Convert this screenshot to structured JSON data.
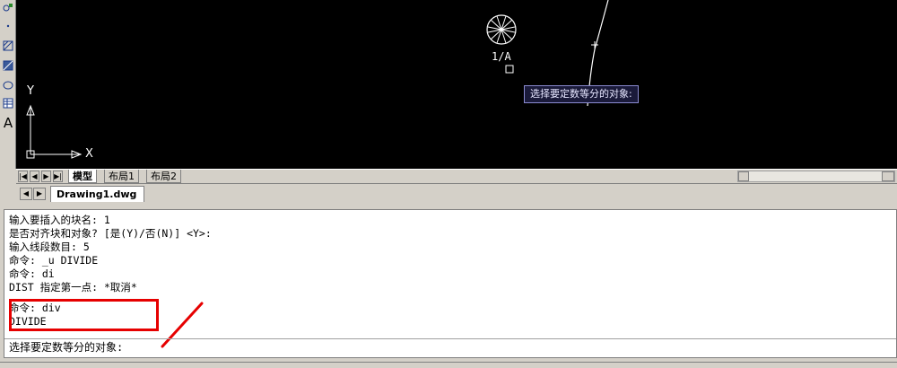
{
  "canvas": {
    "block_label": "1/A",
    "y_axis": "Y",
    "x_axis": "X"
  },
  "tooltip": "选择要定数等分的对象:",
  "left_toolbar": {
    "text_tool_label": "A"
  },
  "layout_tabs": [
    {
      "label": "模型"
    },
    {
      "label": "布局1"
    },
    {
      "label": "布局2"
    }
  ],
  "document": {
    "tab_label": "Drawing1.dwg"
  },
  "command_history": [
    "输入要插入的块名: 1",
    "是否对齐块和对象? [是(Y)/否(N)] <Y>:",
    "输入线段数目: 5",
    "命令: _u DIVIDE",
    "命令: di",
    "DIST 指定第一点: *取消*",
    "命令: div",
    "DIVIDE"
  ],
  "command_prompt": "选择要定数等分的对象:",
  "colors": {
    "canvas_bg": "#000000",
    "highlight": "#e60000",
    "entity_color": "#ffffff"
  }
}
